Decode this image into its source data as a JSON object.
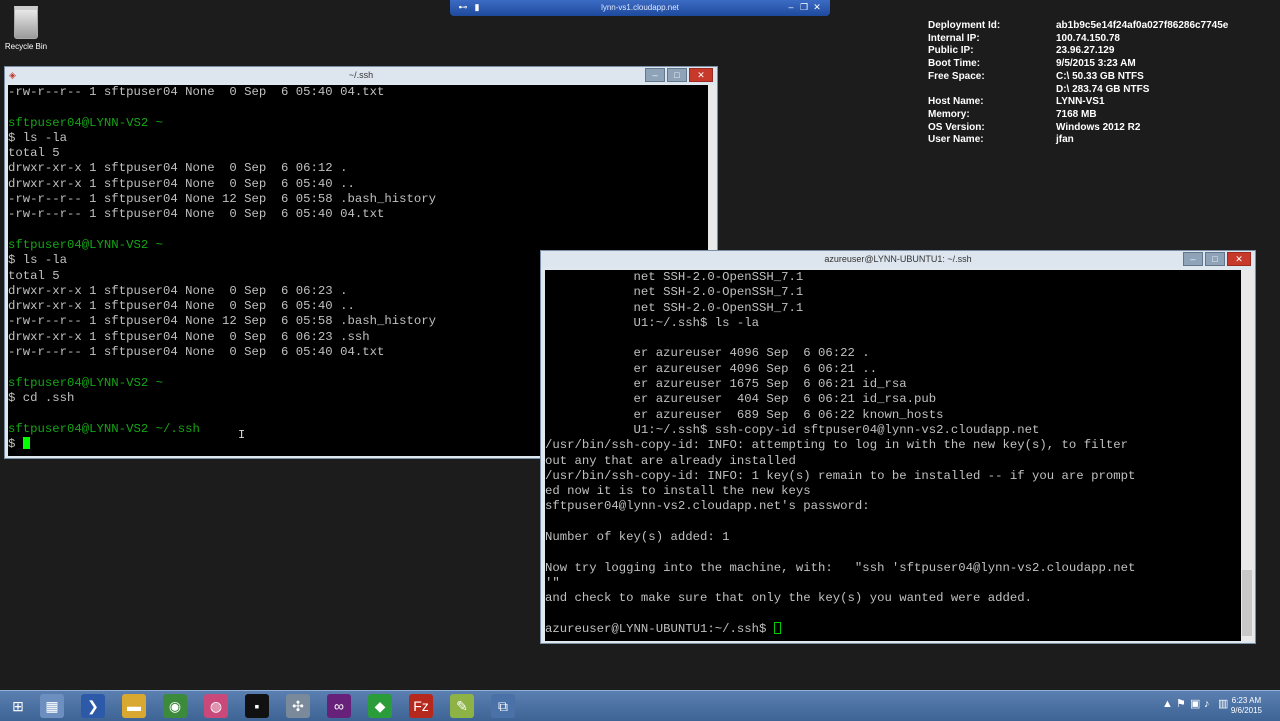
{
  "desktop": {
    "recycle_bin_label": "Recycle Bin"
  },
  "rdp_bar": {
    "title": "lynn-vs1.cloudapp.net"
  },
  "bginfo": [
    {
      "k": "Deployment Id:",
      "v": "ab1b9c5e14f24af0a027f86286c7745e"
    },
    {
      "k": "Internal IP:",
      "v": "100.74.150.78"
    },
    {
      "k": "Public IP:",
      "v": "23.96.27.129"
    },
    {
      "k": "Boot Time:",
      "v": "9/5/2015 3:23 AM"
    },
    {
      "k": "Free Space:",
      "v": "C:\\ 50.33 GB NTFS"
    },
    {
      "k": "",
      "v": "D:\\ 283.74 GB NTFS"
    },
    {
      "k": "Host Name:",
      "v": "LYNN-VS1"
    },
    {
      "k": "Memory:",
      "v": "7168 MB"
    },
    {
      "k": "OS Version:",
      "v": "Windows 2012 R2"
    },
    {
      "k": "User Name:",
      "v": "jfan"
    }
  ],
  "win1": {
    "title": "~/.ssh",
    "lines": [
      {
        "t": "-rw-r--r-- 1 sftpuser04 None  0 Sep  6 05:40 04.txt"
      },
      {
        "t": ""
      },
      {
        "t": "sftpuser04@LYNN-VS2 ~",
        "c": "green"
      },
      {
        "t": "$ ls -la"
      },
      {
        "t": "total 5"
      },
      {
        "t": "drwxr-xr-x 1 sftpuser04 None  0 Sep  6 06:12 ."
      },
      {
        "t": "drwxr-xr-x 1 sftpuser04 None  0 Sep  6 05:40 .."
      },
      {
        "t": "-rw-r--r-- 1 sftpuser04 None 12 Sep  6 05:58 .bash_history"
      },
      {
        "t": "-rw-r--r-- 1 sftpuser04 None  0 Sep  6 05:40 04.txt"
      },
      {
        "t": ""
      },
      {
        "t": "sftpuser04@LYNN-VS2 ~",
        "c": "green"
      },
      {
        "t": "$ ls -la"
      },
      {
        "t": "total 5"
      },
      {
        "t": "drwxr-xr-x 1 sftpuser04 None  0 Sep  6 06:23 ."
      },
      {
        "t": "drwxr-xr-x 1 sftpuser04 None  0 Sep  6 05:40 .."
      },
      {
        "t": "-rw-r--r-- 1 sftpuser04 None 12 Sep  6 05:58 .bash_history"
      },
      {
        "t": "drwxr-xr-x 1 sftpuser04 None  0 Sep  6 06:23 .ssh"
      },
      {
        "t": "-rw-r--r-- 1 sftpuser04 None  0 Sep  6 05:40 04.txt"
      },
      {
        "t": ""
      },
      {
        "t": "sftpuser04@LYNN-VS2 ~",
        "c": "green"
      },
      {
        "t": "$ cd .ssh"
      },
      {
        "t": ""
      },
      {
        "t": "sftpuser04@LYNN-VS2 ~/.ssh",
        "c": "green"
      }
    ],
    "prompt": "$ "
  },
  "win2": {
    "title": "azureuser@LYNN-UBUNTU1: ~/.ssh",
    "lines": [
      "            net SSH-2.0-OpenSSH_7.1",
      "            net SSH-2.0-OpenSSH_7.1",
      "            net SSH-2.0-OpenSSH_7.1",
      "            U1:~/.ssh$ ls -la",
      "",
      "            er azureuser 4096 Sep  6 06:22 .",
      "            er azureuser 4096 Sep  6 06:21 ..",
      "            er azureuser 1675 Sep  6 06:21 id_rsa",
      "            er azureuser  404 Sep  6 06:21 id_rsa.pub",
      "            er azureuser  689 Sep  6 06:22 known_hosts",
      "            U1:~/.ssh$ ssh-copy-id sftpuser04@lynn-vs2.cloudapp.net",
      "/usr/bin/ssh-copy-id: INFO: attempting to log in with the new key(s), to filter",
      "out any that are already installed",
      "/usr/bin/ssh-copy-id: INFO: 1 key(s) remain to be installed -- if you are prompt",
      "ed now it is to install the new keys",
      "sftpuser04@lynn-vs2.cloudapp.net's password:",
      "",
      "Number of key(s) added: 1",
      "",
      "Now try logging into the machine, with:   \"ssh 'sftpuser04@lynn-vs2.cloudapp.net",
      "'\"",
      "and check to make sure that only the key(s) you wanted were added.",
      ""
    ],
    "prompt": "azureuser@LYNN-UBUNTU1:~/.ssh$ "
  },
  "taskbar": {
    "items": [
      {
        "name": "start-button",
        "icon": "⊞",
        "bg": "transparent"
      },
      {
        "name": "server-manager-icon",
        "icon": "▦",
        "bg": "#6d8fbf"
      },
      {
        "name": "powershell-icon",
        "icon": "❯",
        "bg": "#2d5aa8"
      },
      {
        "name": "file-explorer-icon",
        "icon": "▬",
        "bg": "#d9a830"
      },
      {
        "name": "chrome-icon",
        "icon": "◉",
        "bg": "#3c8a3c"
      },
      {
        "name": "app-circle-icon",
        "icon": "◍",
        "bg": "#c94a7a"
      },
      {
        "name": "cygwin-terminal-icon",
        "icon": "▪",
        "bg": "#111"
      },
      {
        "name": "tools-icon",
        "icon": "✣",
        "bg": "#7a8a9a"
      },
      {
        "name": "visual-studio-icon",
        "icon": "∞",
        "bg": "#68217a"
      },
      {
        "name": "git-icon",
        "icon": "◆",
        "bg": "#2a9d3a"
      },
      {
        "name": "filezilla-icon",
        "icon": "Fz",
        "bg": "#b7281c"
      },
      {
        "name": "notepad-icon",
        "icon": "✎",
        "bg": "#8db347"
      },
      {
        "name": "network-icon",
        "icon": "⧉",
        "bg": "#4a72a8"
      }
    ],
    "tray_icons": [
      "▲",
      "⚑",
      "▣",
      "♪",
      "▥"
    ],
    "time": "6:23 AM",
    "date": "9/6/2015"
  }
}
